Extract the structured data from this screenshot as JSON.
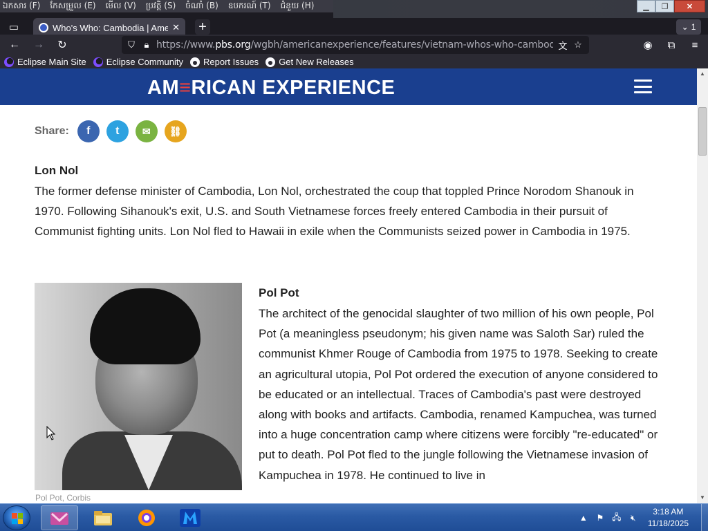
{
  "browser": {
    "menu": [
      "ឯកសារ (F)",
      "កែសម្រួល (E)",
      "មើល (V)",
      "ប្រវត្តិ (S)",
      "ចំណាំ (B)",
      "ឧបករណ៍ (T)",
      "ជំនួយ (H)"
    ],
    "tab_title": "Who's Who: Cambodia | Ame",
    "tab_close": "✕",
    "new_tab": "+",
    "tab_count": "1",
    "url_prefix": "https://www.",
    "url_domain": "pbs.org",
    "url_path": "/wgbh/americanexperience/features/vietnam-whos-who-cambodia",
    "bookmarks": [
      "Eclipse Main Site",
      "Eclipse Community",
      "Report Issues",
      "Get New Releases"
    ],
    "icons": [
      "tab-list-icon",
      "back-icon",
      "forward-icon",
      "reload-icon",
      "shield-icon",
      "lock-icon",
      "translate-icon",
      "bookmark-star-icon",
      "account-icon",
      "extensions-icon",
      "menu-icon"
    ]
  },
  "site": {
    "logo_pre": "AM",
    "logo_e": "≡",
    "logo_post": "RICAN EXPERIENCE",
    "colors": {
      "header": "#1a3f8f",
      "logo_accent": "#e9413d"
    }
  },
  "share": {
    "label": "Share:",
    "buttons": [
      {
        "name": "facebook-icon",
        "glyph": "f",
        "color": "#3b66b0"
      },
      {
        "name": "twitter-icon",
        "glyph": "t",
        "color": "#2da2e0"
      },
      {
        "name": "email-icon",
        "glyph": "✉",
        "color": "#7ab341"
      },
      {
        "name": "link-icon",
        "glyph": "⛓",
        "color": "#e6a51e"
      }
    ]
  },
  "entries": [
    {
      "name": "Lon Nol",
      "text": "The former defense minister of Cambodia, Lon Nol, orchestrated the coup that toppled Prince Norodom Shanouk in 1970. Following Sihanouk's exit, U.S. and South Vietnamese forces freely entered Cambodia in their pursuit of Communist fighting units. Lon Nol fled to Hawaii in exile when the Communists seized power in Cambodia in 1975."
    },
    {
      "name": "Pol Pot",
      "text": "The architect of the genocidal slaughter of two million of his own people, Pol Pot (a meaningless pseudonym; his given name was Saloth Sar) ruled the communist Khmer Rouge of Cambodia from 1975 to 1978. Seeking to create an agricultural utopia, Pol Pot ordered the execution of anyone considered to be educated or an intellectual. Traces of Cambodia's past were destroyed along with books and artifacts. Cambodia, renamed Kampuchea, was turned into a huge concentration camp where citizens were forcibly \"re-educated\" or put to death. Pol Pot fled to the jungle following the Vietnamese invasion of Kampuchea in 1978. He continued to live in",
      "photo_caption": "Pol Pot, Corbis"
    }
  ],
  "taskbar": {
    "time": "3:18 AM",
    "date": "11/18/2025",
    "apps": [
      "app-icon",
      "file-explorer-icon",
      "firefox-icon",
      "malwarebytes-icon"
    ]
  }
}
